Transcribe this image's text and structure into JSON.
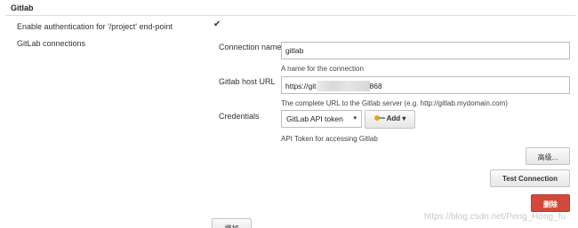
{
  "section": {
    "title": "Gitlab"
  },
  "auth": {
    "label": "Enable authentication for '/project' end-point",
    "checked": true,
    "check_glyph": "✔"
  },
  "connections": {
    "label": "GitLab connections"
  },
  "form": {
    "name_label": "Connection name",
    "name_value": "gitlab",
    "name_help": "A name for the connection",
    "host_label": "Gitlab host URL",
    "host_value_prefix": "https://git",
    "host_value_suffix": "868",
    "host_help": "The complete URL to the Gitlab server (e.g. http://gitlab.mydomain.com)",
    "cred_label": "Credentials",
    "cred_value": "GitLab API token",
    "cred_help": "API Token for accessing Gitlab",
    "add_label": "Add",
    "caret": "▾"
  },
  "buttons": {
    "advanced": "高级...",
    "test": "Test Connection",
    "delete": "删除",
    "add_bottom": "增加"
  },
  "watermark": "https://blog.csdn.net/Peng_Hong_fu",
  "colors": {
    "delete": "#d24939",
    "key_icon": "#e0a81a"
  }
}
